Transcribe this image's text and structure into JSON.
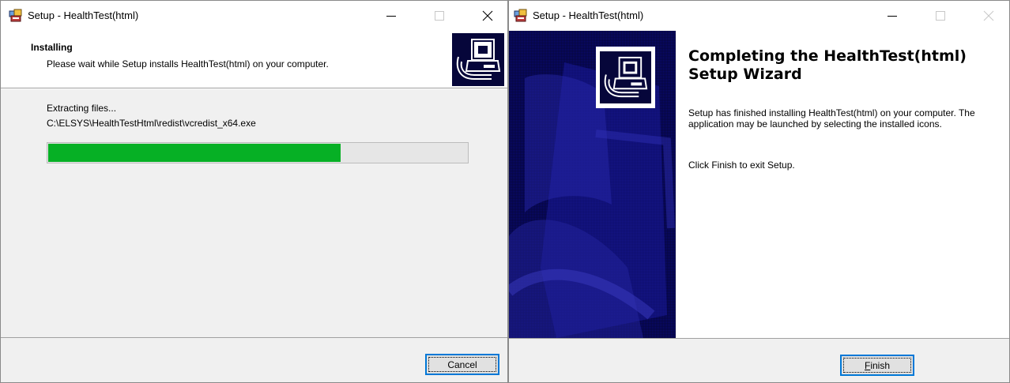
{
  "colors": {
    "progress_fill": "#06b025",
    "side_panel": "#0a0a6e",
    "focus_border": "#0078d7"
  },
  "left_window": {
    "title": "Setup - HealthTest(html)",
    "header": {
      "title": "Installing",
      "subtitle": "Please wait while Setup installs HealthTest(html) on your computer."
    },
    "status": "Extracting files...",
    "current_file": "C:\\ELSYS\\HealthTestHtml\\redist\\vcredist_x64.exe",
    "progress_fraction": 0.7,
    "cancel_label": "Cancel"
  },
  "right_window": {
    "title": "Setup - HealthTest(html)",
    "heading": "Completing the HealthTest(html) Setup Wizard",
    "body_text": "Setup has finished installing HealthTest(html) on your computer. The application may be launched by selecting the installed icons.",
    "finish_instruction": "Click Finish to exit Setup.",
    "finish_label_accel": "F",
    "finish_label_rest": "inish"
  },
  "icons": [
    "setup-app-icon",
    "minimize-icon",
    "maximize-icon",
    "close-icon",
    "installer-computer-icon"
  ]
}
